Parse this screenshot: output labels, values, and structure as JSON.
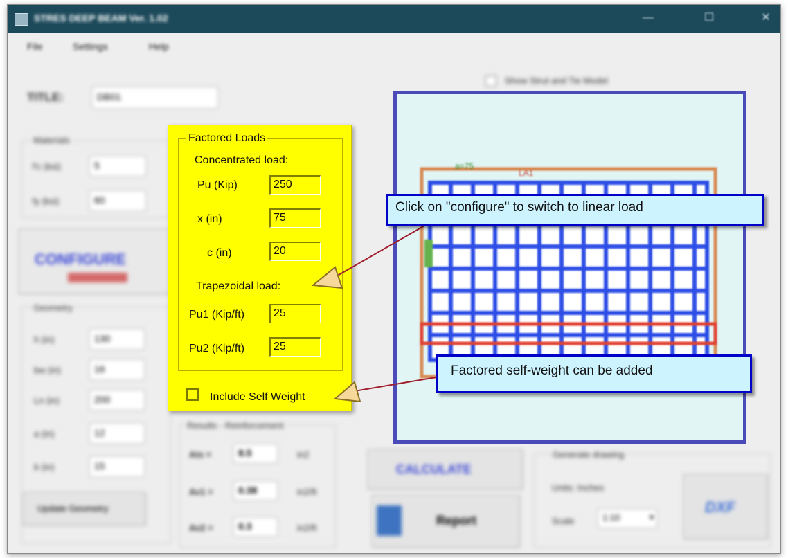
{
  "window": {
    "title": "STRES DEEP BEAM Ver. 1.02",
    "controls": [
      "—",
      "☐",
      "✕"
    ]
  },
  "menu": [
    "File",
    "Settings",
    "Help"
  ],
  "title_field": {
    "label": "TITLE:",
    "value": "DB01"
  },
  "materials": {
    "group_label": "Materials",
    "rows": [
      {
        "label": "f'c (ksi)",
        "value": "5"
      },
      {
        "label": "fy (ksi)",
        "value": "60"
      }
    ]
  },
  "configure_button": "CONFIGURE",
  "geometry": {
    "group_label": "Geometry",
    "rows": [
      {
        "label": "h (in)",
        "value": "130"
      },
      {
        "label": "bw (in)",
        "value": "16"
      },
      {
        "label": "Ln (in)",
        "value": "200"
      },
      {
        "label": "a (in)",
        "value": "12"
      },
      {
        "label": "b (in)",
        "value": "15"
      }
    ],
    "update_button": "Update Geometry"
  },
  "factored_loads": {
    "group_label": "Factored Loads",
    "concentrated_label": "Concentrated load:",
    "pu_label": "Pu (Kip)",
    "pu_value": "250",
    "x_label": "x (in)",
    "x_value": "75",
    "c_label": "c (in)",
    "c_value": "20",
    "trapezoidal_label": "Trapezoidal load:",
    "pu1_label": "Pu1 (Kip/ft)",
    "pu1_value": "25",
    "pu2_label": "Pu2 (Kip/ft)",
    "pu2_value": "25",
    "self_weight_label": "Include Self Weight",
    "self_weight_checked": false
  },
  "results": {
    "group_label": "Results - Reinforcement",
    "rows": [
      {
        "label": "Ats =",
        "value": "8.5",
        "unit": "in2"
      },
      {
        "label": "Av1 =",
        "value": "0.38",
        "unit": "in2/ft"
      },
      {
        "label": "Av2 =",
        "value": "0.3",
        "unit": "in2/ft"
      }
    ]
  },
  "calculate_button": "CALCULATE",
  "report_button": "Report",
  "drawing": {
    "group_label": "Generate drawing",
    "units_label": "Units: Inches",
    "scale_label": "Scale",
    "scale_value": "1:10",
    "dxf_label": "DXF"
  },
  "show_strut_tie": "Show Strut and Tie Model",
  "diagram_labels": {
    "left": "a=75",
    "top": "LA1"
  },
  "callouts": {
    "configure": "Click on \"configure\" to switch to linear load",
    "self_weight": "Factored self-weight can be added"
  },
  "colors": {
    "panel_yellow": "#ffff00",
    "callout_fill": "#cdf3ff",
    "callout_border": "#0000c8",
    "arrow": "#a01e2e",
    "titlebar": "#1d4a5b",
    "mesh_blue": "#2c4de6",
    "tie_orange": "#d88850",
    "tie_red": "#e04030"
  }
}
